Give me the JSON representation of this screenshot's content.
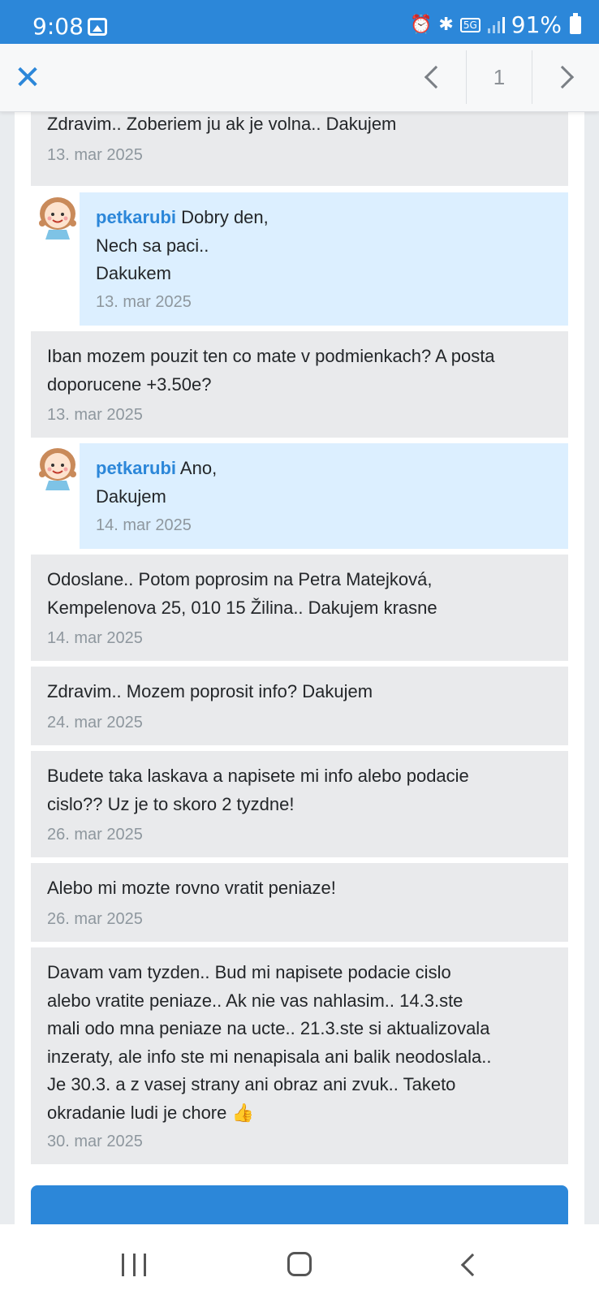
{
  "status_bar": {
    "time": "9:08",
    "network": "5G",
    "battery": "91%",
    "icons": [
      "gallery-icon",
      "alarm-icon",
      "bluetooth-icon",
      "5g-icon",
      "signal-icon",
      "battery-icon"
    ]
  },
  "toolbar": {
    "close_icon": "close-icon",
    "prev_icon": "chevron-left-icon",
    "page_number": "1",
    "next_icon": "chevron-right-icon"
  },
  "messages": [
    {
      "type": "incoming",
      "text": "Zdravim.. Zoberiem ju ak je volna.. Dakujem",
      "date": "13. mar 2025"
    },
    {
      "type": "reply",
      "author": "petkarubi",
      "text": " Dobry den,\nNech sa paci..\nDakukem",
      "date": "13. mar 2025"
    },
    {
      "type": "incoming",
      "text": "Iban mozem pouzit ten co mate v podmienkach? A posta doporucene +3.50e?",
      "date": "13. mar 2025"
    },
    {
      "type": "reply",
      "author": "petkarubi",
      "text": " Ano,\nDakujem",
      "date": "14. mar 2025"
    },
    {
      "type": "incoming",
      "text": "Odoslane.. Potom poprosim na Petra Matejková, Kempelenova 25, 010 15 Žilina.. Dakujem krasne",
      "date": "14. mar 2025"
    },
    {
      "type": "incoming",
      "text": "Zdravim.. Mozem poprosit info? Dakujem",
      "date": "24. mar 2025"
    },
    {
      "type": "incoming",
      "text": "Budete taka laskava a napisete mi info alebo podacie cislo?? Uz je to skoro 2 tyzdne!",
      "date": "26. mar 2025"
    },
    {
      "type": "incoming",
      "text": "Alebo mi mozte rovno vratit peniaze!",
      "date": "26. mar 2025"
    },
    {
      "type": "incoming",
      "text": "Davam vam tyzden.. Bud mi napisete podacie cislo alebo vratite peniaze.. Ak nie vas nahlasim.. 14.3.ste mali odo mna peniaze na ucte.. 21.3.ste si aktualizovala inzeraty, ale info ste mi nenapisala ani balik neodoslala.. Je 30.3. a z vasej strany ani obraz ani zvuk.. Taketo okradanie ludi je chore 👍",
      "date": "30. mar 2025"
    }
  ],
  "colors": {
    "accent": "#2c87d9",
    "incoming_bg": "#e9eaec",
    "reply_bg": "#dcefff",
    "date_text": "#8e979e"
  }
}
